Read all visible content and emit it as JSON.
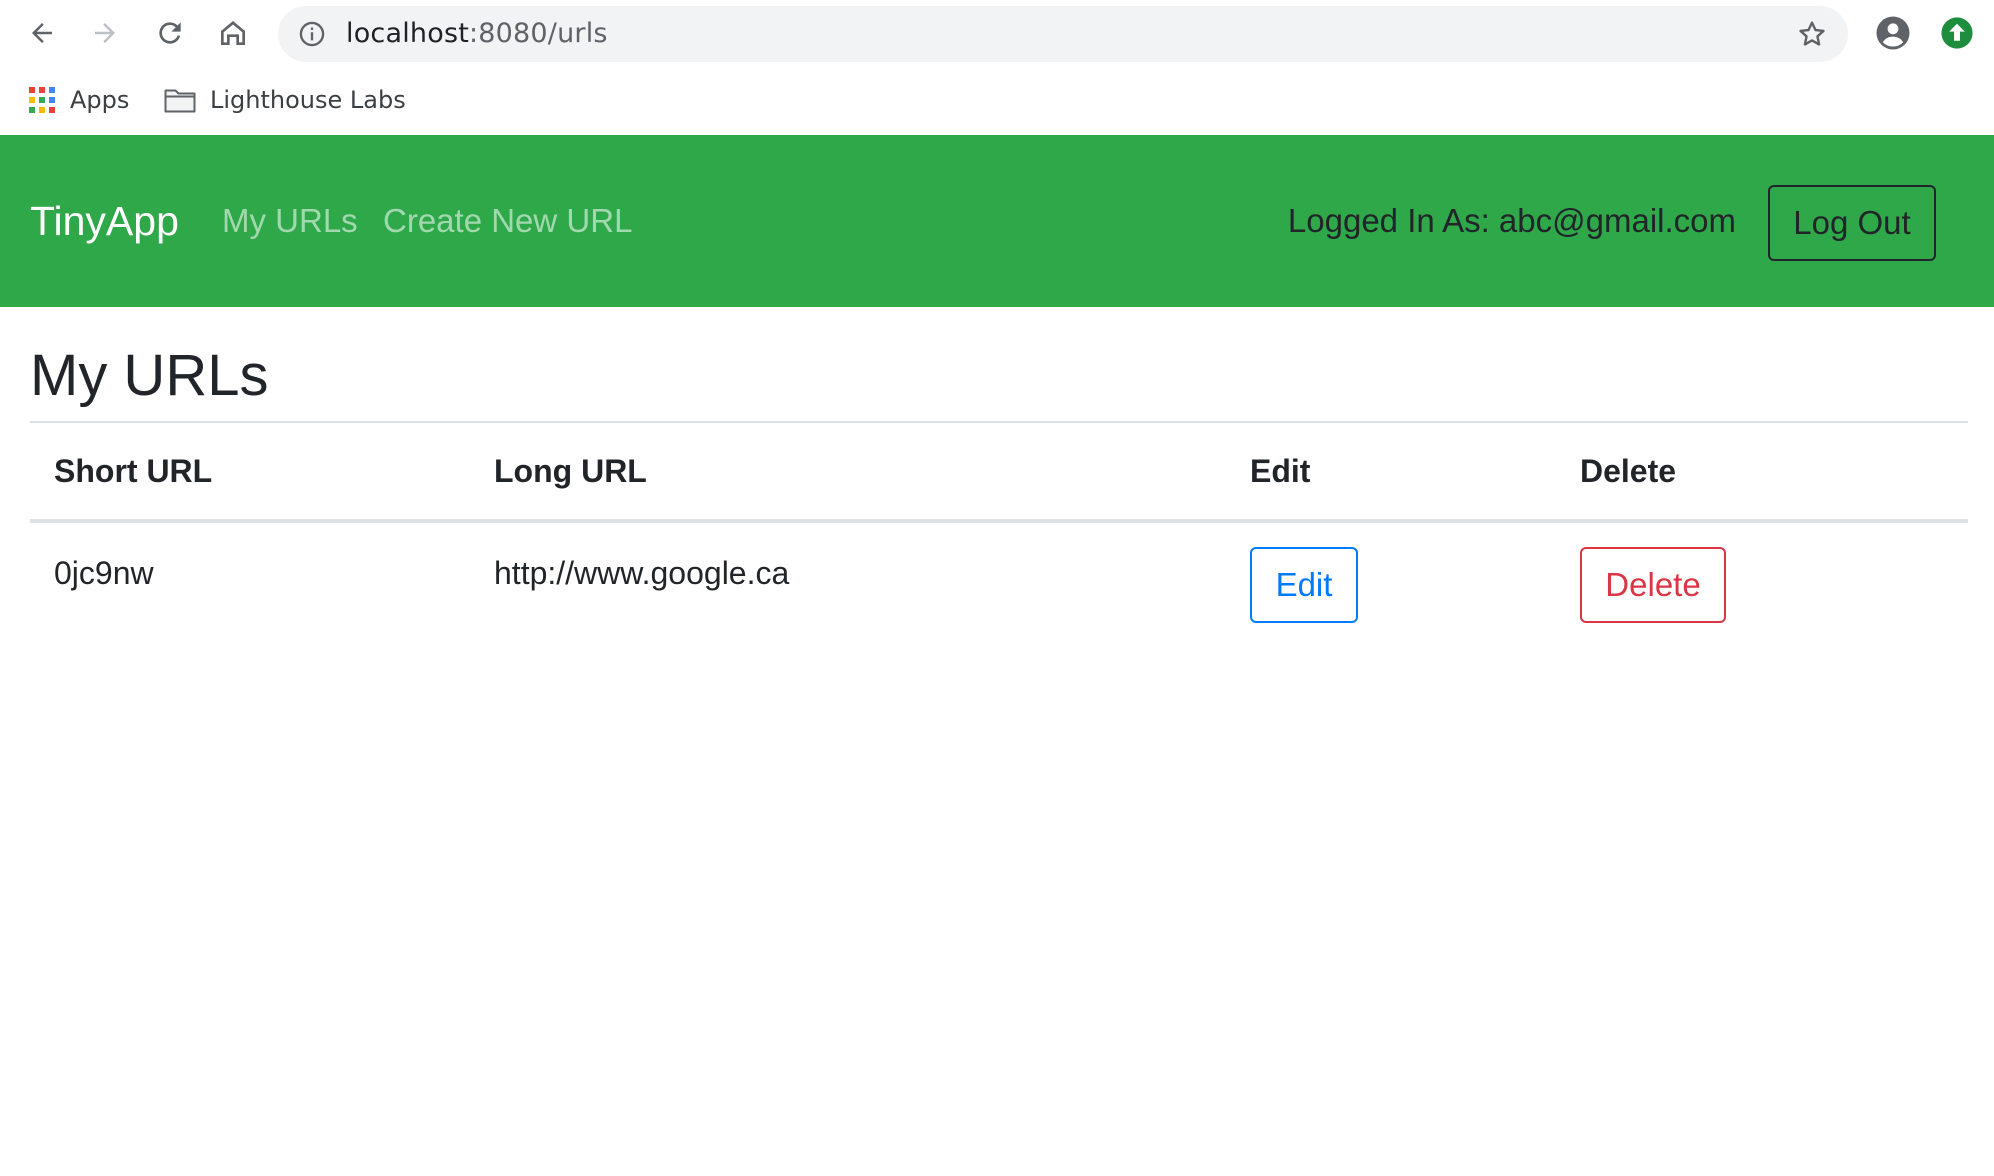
{
  "browser": {
    "url_host": "localhost",
    "url_path": ":8080/urls",
    "bookmarks": [
      {
        "label": "Apps",
        "icon": "apps-grid-icon"
      },
      {
        "label": "Lighthouse Labs",
        "icon": "folder-icon"
      }
    ],
    "colors": {
      "omnibox_bg": "#f1f3f4",
      "update_badge": "#1e8e3e"
    }
  },
  "navbar": {
    "brand": "TinyApp",
    "links": [
      "My URLs",
      "Create New URL"
    ],
    "logged_in_text": "Logged In As: abc@gmail.com",
    "logout_label": "Log Out",
    "color": "#2fa84a"
  },
  "main": {
    "title": "My URLs",
    "table": {
      "headers": [
        "Short URL",
        "Long URL",
        "Edit",
        "Delete"
      ],
      "rows": [
        {
          "short_url": "0jc9nw",
          "long_url": "http://www.google.ca",
          "edit_label": "Edit",
          "delete_label": "Delete"
        }
      ]
    }
  }
}
